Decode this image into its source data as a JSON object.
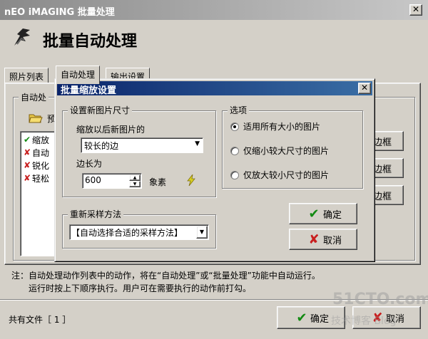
{
  "window": {
    "title": "nEO iMAGING 批量处理",
    "close_glyph": "✕",
    "header_title": "批量自动处理"
  },
  "tabs": [
    {
      "label": "照片列表"
    },
    {
      "label": "自动处理"
    },
    {
      "label": "输出设置"
    }
  ],
  "panel": {
    "group_label": "自动处",
    "preview_label": "预",
    "list_items": [
      {
        "label": "缩放",
        "state": "checked"
      },
      {
        "label": "自动",
        "state": "unchecked"
      },
      {
        "label": "锐化",
        "state": "unchecked"
      },
      {
        "label": "轻松",
        "state": "unchecked"
      }
    ],
    "right_buttons": [
      "边框",
      "边框",
      "边框"
    ]
  },
  "note": {
    "line1": "注：自动处理动作列表中的动作，将在“自动处理”或“批量处理”功能中自动运行。",
    "line2": "运行时按上下顺序执行。用户可在需要执行的动作前打勾。"
  },
  "footer": {
    "files_label": "共有文件［ 1 ］",
    "ok_label": "确定",
    "cancel_label": "取消"
  },
  "dialog": {
    "title": "批量缩放设置",
    "close_glyph": "✕",
    "size_group": {
      "label": "设置新图片尺寸",
      "edge_caption": "缩放以后新图片的",
      "edge_select": "较长的边",
      "length_caption": "边长为",
      "length_value": "600",
      "unit": "象素"
    },
    "options_group": {
      "label": "选项",
      "radios": [
        {
          "label": "适用所有大小的图片",
          "selected": true
        },
        {
          "label": "仅缩小较大尺寸的图片",
          "selected": false
        },
        {
          "label": "仅放大较小尺寸的图片",
          "selected": false
        }
      ]
    },
    "resample_group": {
      "label": "重新采样方法",
      "select": "【自动选择合适的采样方法】"
    },
    "ok_label": "确定",
    "cancel_label": "取消"
  },
  "watermark": {
    "line1": "51CTO.com",
    "line2": "技术博客 Blog"
  },
  "colors": {
    "dialog_titlebar": "#0a246a",
    "check": "#128a12",
    "cross": "#c81e1e",
    "face": "#d4d0c8"
  }
}
